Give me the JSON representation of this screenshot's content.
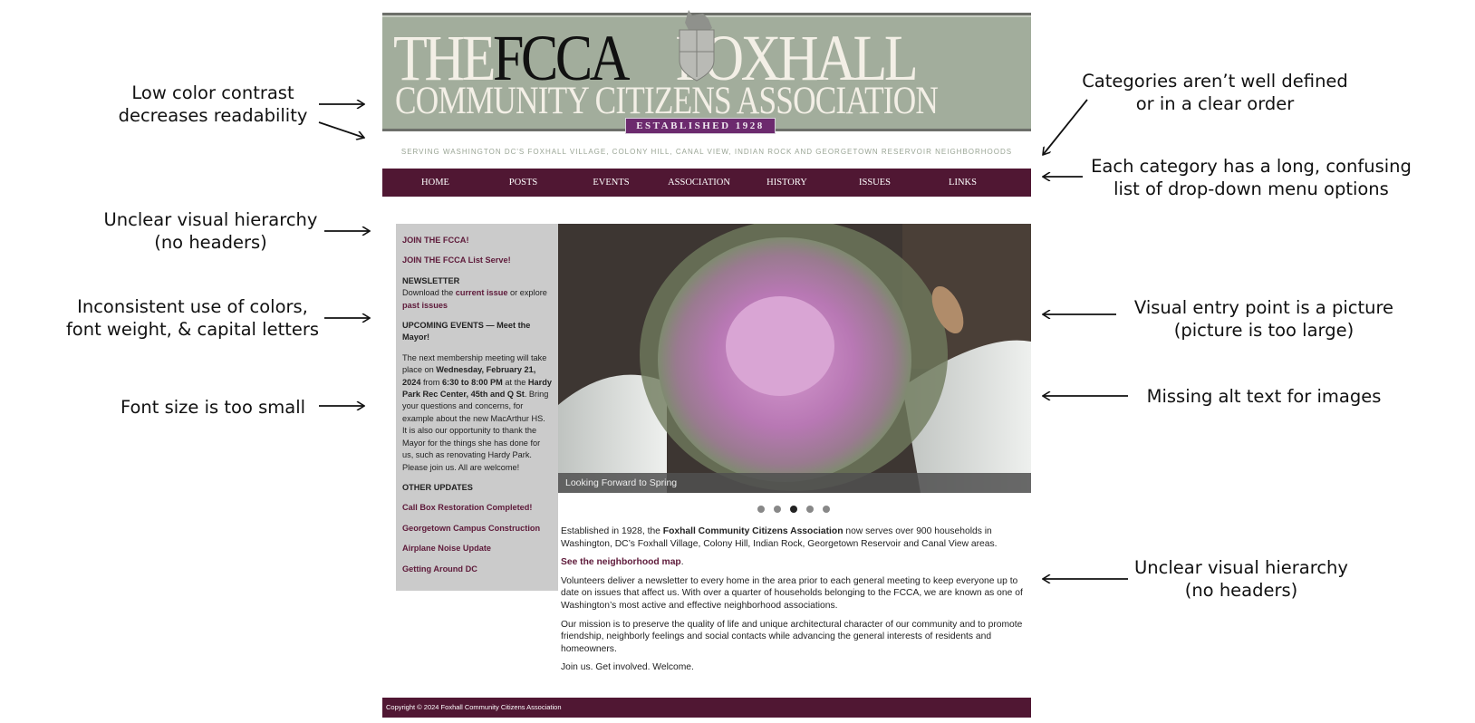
{
  "annotations": {
    "left": [
      {
        "lines": [
          "Low color contrast",
          "decreases readability"
        ]
      },
      {
        "lines": [
          "Unclear visual hierarchy",
          "(no headers)"
        ]
      },
      {
        "lines": [
          "Inconsistent use of colors,",
          "font weight, & capital letters"
        ]
      },
      {
        "lines": [
          "Font size is too small"
        ]
      }
    ],
    "right": [
      {
        "lines": [
          "Categories aren’t well defined",
          "or in a clear order"
        ]
      },
      {
        "lines": [
          "Each category has a long, confusing",
          "list of drop-down menu options"
        ]
      },
      {
        "lines": [
          "Visual entry point is a picture",
          "(picture is too large)"
        ]
      },
      {
        "lines": [
          "Missing alt text for images"
        ]
      },
      {
        "lines": [
          "Unclear visual hierarchy",
          "(no headers)"
        ]
      }
    ]
  },
  "site": {
    "logo": {
      "line1_a": "THE",
      "line1_b": "FCCA",
      "line1_c": "FOXHALL",
      "line2": "COMMUNITY CITIZENS ASSOCIATION",
      "established": "ESTABLISHED 1928"
    },
    "tagline": "SERVING WASHINGTON DC'S FOXHALL VILLAGE, COLONY HILL, CANAL VIEW, INDIAN ROCK AND GEORGETOWN RESERVOIR NEIGHBORHOODS",
    "nav": [
      "HOME",
      "POSTS",
      "EVENTS",
      "ASSOCIATION",
      "HISTORY",
      "ISSUES",
      "LINKS"
    ],
    "sidebar": {
      "join": "JOIN THE FCCA!",
      "listserve": "JOIN THE FCCA List Serve!",
      "newsletter_head": "NEWSLETTER",
      "newsletter_t1": "Download the ",
      "current_issue": "current issue",
      "newsletter_t2": " or explore ",
      "past_issues": "past issues",
      "events_head": "UPCOMING EVENTS — Meet the Mayor!",
      "ev_t1": "The next membership meeting will take place on ",
      "ev_date": "Wednesday, February 21, 2024",
      "ev_t2": " from ",
      "ev_time": "6:30 to 8:00 PM",
      "ev_t3": " at the ",
      "ev_place": "Hardy Park Rec Center, 45th and Q St",
      "ev_t4": ". Bring your questions and concerns, for example about the new MacArthur HS. It is also our opportunity to thank the Mayor for the things she has done for us, such as renovating Hardy Park. Please join us. All are welcome!",
      "updates_head": "OTHER UPDATES",
      "updates": [
        "Call Box Restoration Completed!",
        "Georgetown Campus Construction",
        "Airplane Noise Update",
        "Getting Around DC"
      ]
    },
    "hero": {
      "caption": "Looking Forward to Spring",
      "slides": 5,
      "active_slide": 3
    },
    "main": {
      "p1_a": "Established in 1928, the ",
      "p1_b": "Foxhall Community Citizens Association",
      "p1_c": " now serves over 900 households in Washington, DC’s Foxhall Village, Colony Hill, Indian Rock, Georgetown Reservoir and Canal View areas.",
      "map_link": "See the neighborhood map",
      "map_dot": ".",
      "p2": "Volunteers deliver a newsletter to every home in the area prior to each general meeting to keep everyone up to date on issues that affect us. With over a quarter of households belonging to the FCCA, we are known as one of Washington’s most active and effective neighborhood associations.",
      "p3": "Our mission is to preserve the quality of life and unique architectural character of our community and to promote friendship, neighborly feelings and social contacts while advancing the general interests of residents and homeowners.",
      "p4": "Join us. Get involved. Welcome."
    },
    "footer": "Copyright © 2024 Foxhall Community Citizens Association",
    "colors": {
      "banner": "#a2ad9c",
      "nav": "#501733",
      "link": "#5e1a3a",
      "sidebar": "#cbcbcb",
      "established": "#6c2a6e"
    }
  }
}
